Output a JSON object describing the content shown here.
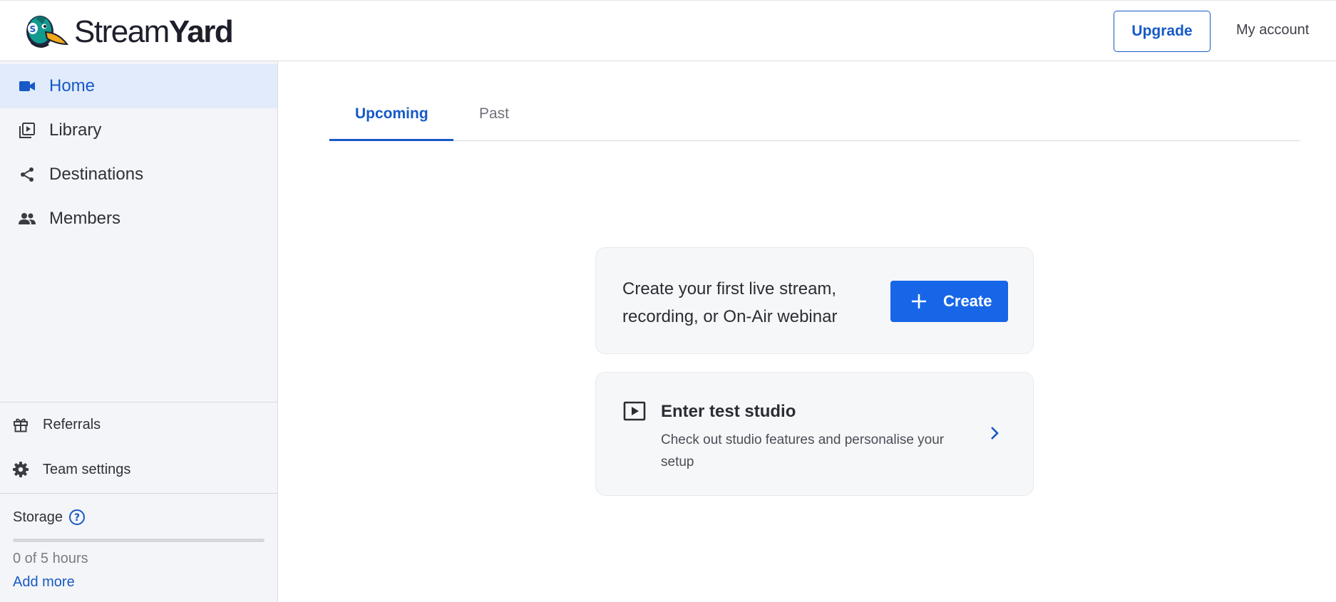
{
  "header": {
    "logo": {
      "name_light": "Stream",
      "name_bold": "Yard",
      "icon": "duck-logo-icon"
    },
    "upgrade_label": "Upgrade",
    "account_label": "My account"
  },
  "sidebar": {
    "items": [
      {
        "label": "Home",
        "icon": "video-camera-icon",
        "active": true
      },
      {
        "label": "Library",
        "icon": "library-icon",
        "active": false
      },
      {
        "label": "Destinations",
        "icon": "share-icon",
        "active": false
      },
      {
        "label": "Members",
        "icon": "people-icon",
        "active": false
      }
    ],
    "bottom_items": [
      {
        "label": "Referrals",
        "icon": "gift-icon"
      },
      {
        "label": "Team settings",
        "icon": "gear-icon"
      }
    ],
    "storage": {
      "label": "Storage",
      "help_icon": "help-circle-icon",
      "used_fraction": 0,
      "usage_text": "0 of 5 hours",
      "add_more_label": "Add more"
    }
  },
  "main": {
    "tabs": [
      {
        "label": "Upcoming",
        "active": true
      },
      {
        "label": "Past",
        "active": false
      }
    ],
    "create_card": {
      "text": "Create your first live stream, recording, or On-Air webinar",
      "button_label": "Create",
      "button_icon": "plus-icon"
    },
    "studio_card": {
      "icon": "play-box-icon",
      "title": "Enter test studio",
      "description": "Check out studio features and personalise your setup",
      "chevron": "chevron-right-icon"
    }
  },
  "colors": {
    "accent": "#1659c7",
    "button_blue": "#1766e8",
    "sidebar_bg": "#f4f5f8",
    "active_item_bg": "#e1ebfb",
    "card_bg": "#f6f7f9"
  }
}
